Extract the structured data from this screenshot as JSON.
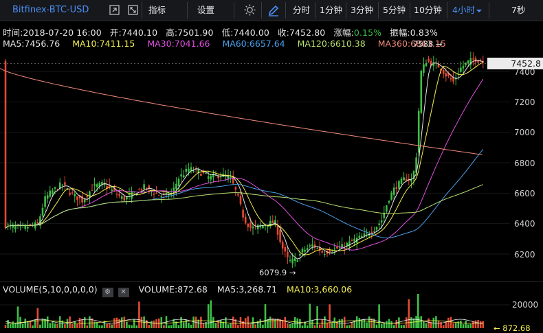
{
  "toolbar": {
    "symbol": "Bitfinex-BTC-USD",
    "indicators_label": "指标",
    "settings_label": "设置",
    "timeframes": [
      "分时",
      "1分钟",
      "3分钟",
      "5分钟",
      "10分钟",
      "4小时"
    ],
    "active_timeframe": "4小时",
    "countdown": "7秒"
  },
  "info_bar": {
    "time": "时间:2018-07-20 16:00",
    "open": "开:7440.10",
    "high": "高:7501.90",
    "low": "低:7440.00",
    "close": "收:7452.80",
    "change_label": "涨幅:",
    "change_value": "0.15%",
    "amplitude": "振幅:0.83%"
  },
  "ma_bar": {
    "ma5": "MA5:7456.76",
    "ma10": "MA10:7411.15",
    "ma30": "MA30:7041.66",
    "ma60": "MA60:6657.64",
    "ma120": "MA120:6610.38",
    "ma360": "MA360:6863.15"
  },
  "volume_bar": {
    "params": "VOLUME(5,10,0,0,0,0)",
    "volume": "VOLUME:872.68",
    "ma5": "MA5:3,268.71",
    "ma10": "MA10:3,660.06"
  },
  "price_axis": [
    "7400",
    "7200",
    "7000",
    "6800",
    "6600",
    "6400",
    "6200"
  ],
  "volume_axis": [
    "20000"
  ],
  "current_price": "7452.8",
  "current_volume": "← 872.68",
  "high_marker": "7588 →",
  "low_marker": "6079.9 →",
  "colors": {
    "up": "#3fbf46",
    "down": "#e34b33",
    "accent": "#4a8ff5",
    "ma5": "#e8e8e8",
    "ma10": "#f5f050",
    "ma30": "#e050e0",
    "ma60": "#4aa0ee",
    "ma120": "#b8e070",
    "ma360": "#f08a7a"
  }
}
